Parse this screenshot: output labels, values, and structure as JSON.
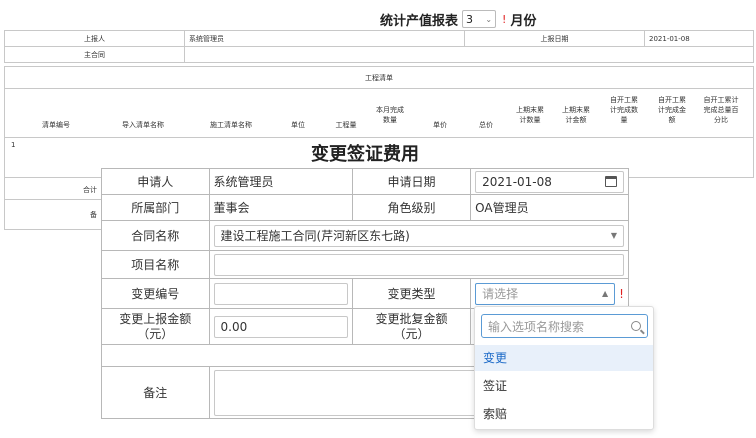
{
  "background_report": {
    "title_prefix": "统计产值报表",
    "month_value": "3",
    "month_suffix": "月份",
    "required_mark": "!",
    "reporter_label": "上报人",
    "reporter_value": "系统管理员",
    "report_date_label": "上报日期",
    "report_date_value": "2021-01-08",
    "main_contract_label": "主合同",
    "project_list_label": "工程清单",
    "columns": [
      "清单编号",
      "导入清单名称",
      "施工清单名称",
      "单位",
      "工程量",
      "本月完成数量",
      "单价",
      "总价",
      "上期末累计数量",
      "上期末累计金额",
      "自开工累计完成数量",
      "自开工累计完成金额",
      "自开工累计完成总量百分比"
    ],
    "row_number": "1",
    "total_label": "合计",
    "remark_label": "备"
  },
  "dialog": {
    "title": "变更签证费用",
    "applicant_label": "申请人",
    "applicant_value": "系统管理员",
    "apply_date_label": "申请日期",
    "apply_date_value": "2021-01-08",
    "department_label": "所属部门",
    "department_value": "董事会",
    "role_label": "角色级别",
    "role_value": "OA管理员",
    "contract_label": "合同名称",
    "contract_value": "建设工程施工合同(芹河新区东七路)",
    "project_label": "项目名称",
    "project_value": "",
    "change_no_label": "变更编号",
    "change_no_value": "",
    "change_type_label": "变更类型",
    "change_type_placeholder": "请选择",
    "required_mark": "!",
    "report_amount_label_1": "变更上报金额",
    "report_amount_label_2": "（元）",
    "report_amount_value": "0.00",
    "approve_amount_label_1": "变更批复金额",
    "approve_amount_label_2": "（元）",
    "remark_label": "备注"
  },
  "dropdown": {
    "search_placeholder": "输入选项名称搜索",
    "options": [
      "变更",
      "签证",
      "索赔"
    ],
    "highlighted_index": 0,
    "highlight_color": "#1c6ac7"
  }
}
